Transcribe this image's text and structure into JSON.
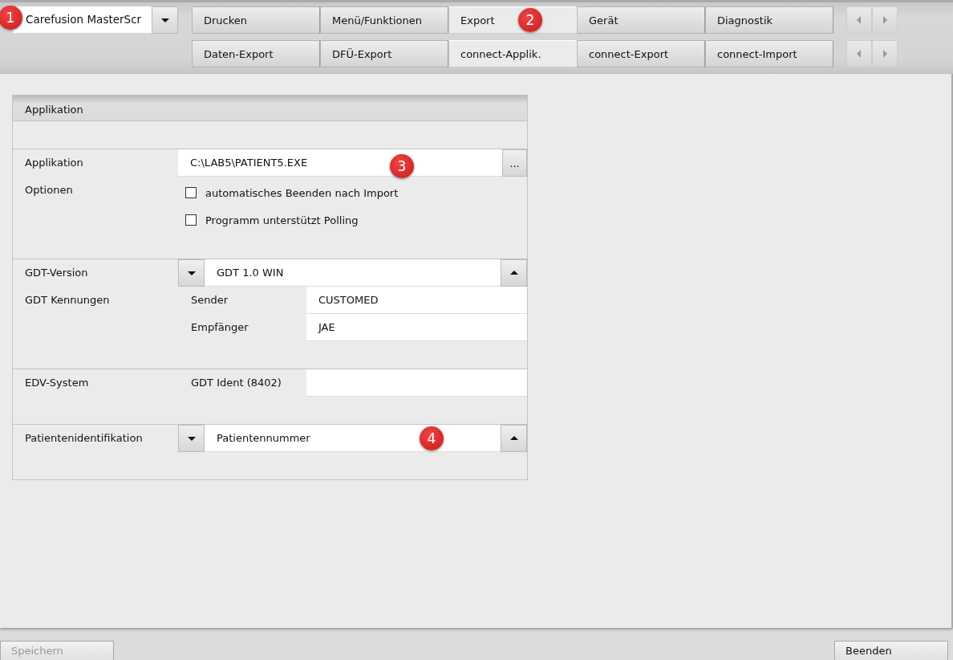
{
  "profile_select": {
    "value": "Carefusion MasterScr"
  },
  "tab_rows": [
    {
      "tabs": [
        {
          "label": "Drucken",
          "selected": false
        },
        {
          "label": "Menü/Funktionen",
          "selected": false
        },
        {
          "label": "Export",
          "selected": true
        },
        {
          "label": "Gerät",
          "selected": false
        },
        {
          "label": "Diagnostik",
          "selected": false
        }
      ]
    },
    {
      "tabs": [
        {
          "label": "Daten-Export",
          "selected": false
        },
        {
          "label": "DFÜ-Export",
          "selected": false
        },
        {
          "label": "connect-Applik.",
          "selected": true
        },
        {
          "label": "connect-Export",
          "selected": false
        },
        {
          "label": "connect-Import",
          "selected": false
        }
      ]
    }
  ],
  "panel": {
    "title": "Applikation",
    "application": {
      "label": "Applikation",
      "value": "C:\\LAB5\\PATIENT5.EXE",
      "browse": "..."
    },
    "options": {
      "label": "Optionen",
      "items": [
        {
          "label": "automatisches Beenden nach Import",
          "checked": false
        },
        {
          "label": "Programm unterstützt Polling",
          "checked": false
        }
      ]
    },
    "gdt_version": {
      "label": "GDT-Version",
      "value": "GDT 1.0 WIN"
    },
    "gdt_ids": {
      "label": "GDT Kennungen",
      "fields": [
        {
          "label": "Sender",
          "value": "CUSTOMED"
        },
        {
          "label": "Empfänger",
          "value": "JAE"
        }
      ]
    },
    "edv_system": {
      "label": "EDV-System",
      "field_label": "GDT Ident (8402)"
    },
    "patient_id": {
      "label": "Patientenidentifikation",
      "value": "Patientennummer"
    }
  },
  "footer": {
    "buttons": [
      {
        "label": "Speichern",
        "disabled": true
      },
      {
        "label": "Beenden",
        "disabled": false
      }
    ]
  },
  "callouts": [
    "1",
    "2",
    "3",
    "4"
  ]
}
